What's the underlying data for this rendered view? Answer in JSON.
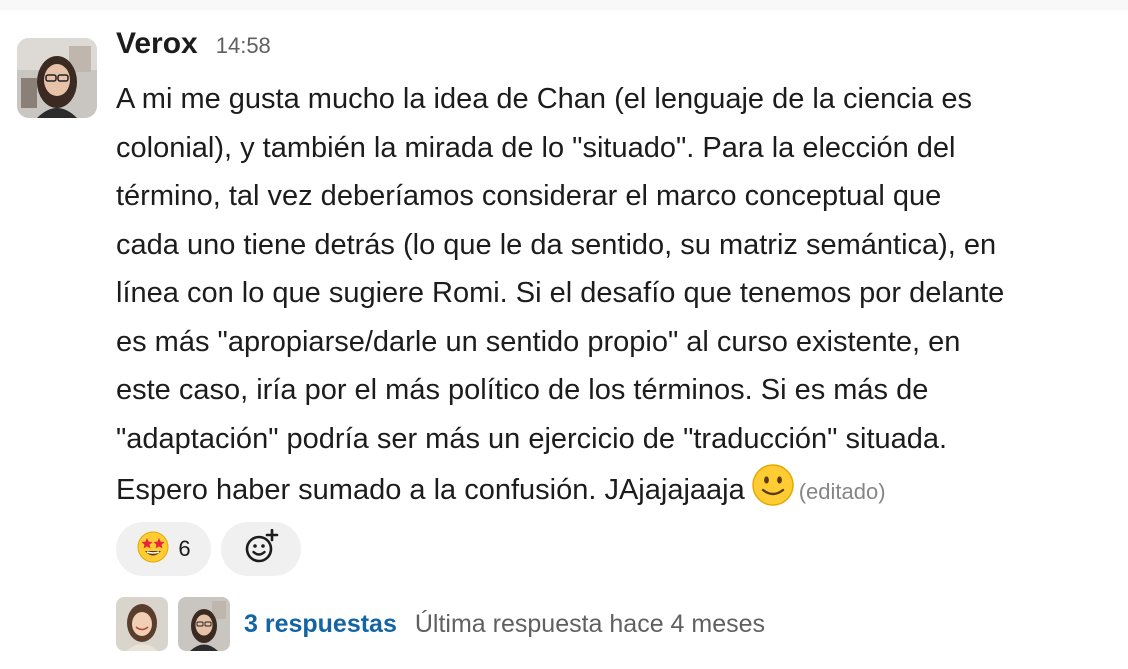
{
  "message": {
    "author": "Verox",
    "timestamp": "14:58",
    "lines": [
      "A mi me gusta mucho la idea de Chan (el lenguaje de la ciencia es",
      "colonial), y también la mirada de lo \"situado\". Para la elección del",
      "término, tal vez deberíamos considerar el marco conceptual que",
      "cada uno tiene detrás (lo que le da sentido, su matriz semántica), en",
      "línea con lo que sugiere Romi. Si el desafío que tenemos por delante",
      "es más \"apropiarse/darle un sentido propio\" al curso existente, en",
      "este caso, iría por el más político de los términos. Si es más de",
      "\"adaptación\" podría ser más un ejercicio de \"traducción\" situada.",
      "Espero haber sumado a la confusión. JAjajajaaja"
    ],
    "emoji_inline": "slightly-smiling-face",
    "edited_label": "(editado)"
  },
  "reactions": [
    {
      "emoji": "star-struck",
      "count": "6"
    }
  ],
  "add_reaction_icon": "add-reaction-icon",
  "thread": {
    "replies_label": "3 respuestas",
    "last_reply_label": "Última respuesta hace 4 meses"
  },
  "colors": {
    "link": "#1264a3",
    "muted": "#616061",
    "reaction_bg": "#f0f0f0"
  }
}
